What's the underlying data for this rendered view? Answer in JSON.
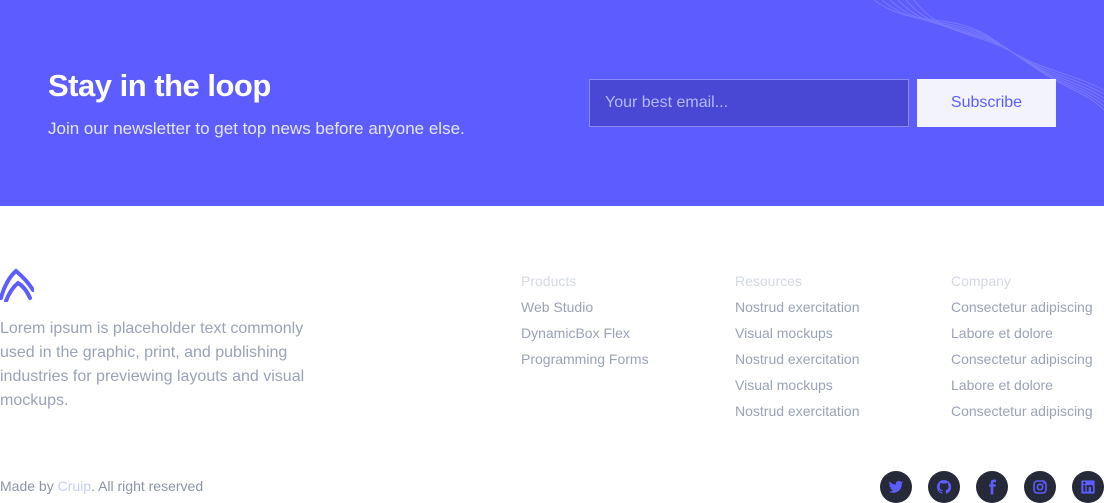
{
  "newsletter": {
    "title": "Stay in the loop",
    "subtitle": "Join our newsletter to get top news before anyone else.",
    "email_placeholder": "Your best email...",
    "email_value": "",
    "subscribe_label": "Subscribe"
  },
  "footer": {
    "logo_icon": "logo-icon",
    "description": "Lorem ipsum is placeholder text commonly used in the graphic, print, and publishing industries for previewing layouts and visual mockups.",
    "columns": [
      {
        "heading": "Products",
        "links": [
          "Web Studio",
          "DynamicBox Flex",
          "Programming Forms"
        ]
      },
      {
        "heading": "Resources",
        "links": [
          "Nostrud exercitation",
          "Visual mockups",
          "Nostrud exercitation",
          "Visual mockups",
          "Nostrud exercitation"
        ]
      },
      {
        "heading": "Company",
        "links": [
          "Consectetur adipiscing",
          "Labore et dolore",
          "Consectetur adipiscing",
          "Labore et dolore",
          "Consectetur adipiscing"
        ]
      }
    ],
    "made_by_prefix": "Made by ",
    "brand": "Cruip",
    "made_by_suffix": ". All right reserved",
    "social_icons": [
      "twitter-icon",
      "github-icon",
      "facebook-icon",
      "instagram-icon",
      "linkedin-icon"
    ]
  },
  "colors": {
    "accent": "#5d5dff",
    "social_bg": "#262a38",
    "muted_text": "#9aa3b5"
  }
}
